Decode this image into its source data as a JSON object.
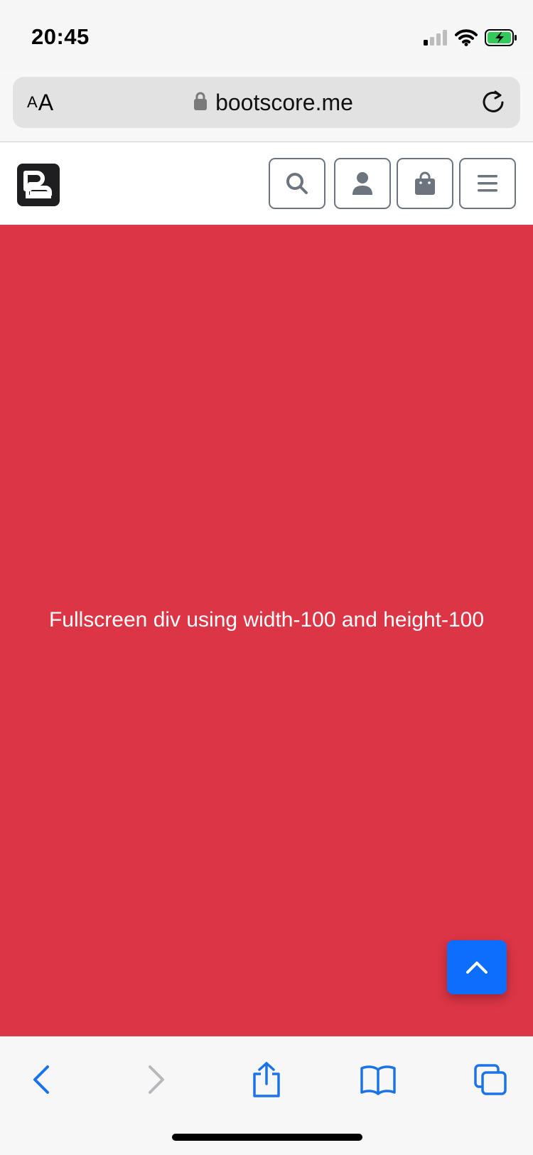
{
  "status_bar": {
    "time": "20:45",
    "icons": [
      "cellular-signal-icon",
      "wifi-icon",
      "battery-charging-icon"
    ]
  },
  "browser": {
    "text_size_small": "A",
    "text_size_large": "A",
    "url": "bootscore.me",
    "icons": [
      "lock-icon",
      "reload-icon"
    ]
  },
  "site_header": {
    "logo_icon": "bootscore-logo",
    "buttons": [
      "search-icon",
      "user-icon",
      "shopping-bag-icon",
      "menu-icon"
    ]
  },
  "hero": {
    "text": "Fullscreen div using width-100 and height-100",
    "background_color": "#dc3545"
  },
  "to_top_button": {
    "icon": "chevron-up-icon",
    "color": "#0d6efd"
  },
  "toolbar": {
    "buttons": [
      "back-icon",
      "forward-icon",
      "share-icon",
      "bookmarks-icon",
      "tabs-icon"
    ],
    "accent_color": "#1a73e8"
  }
}
